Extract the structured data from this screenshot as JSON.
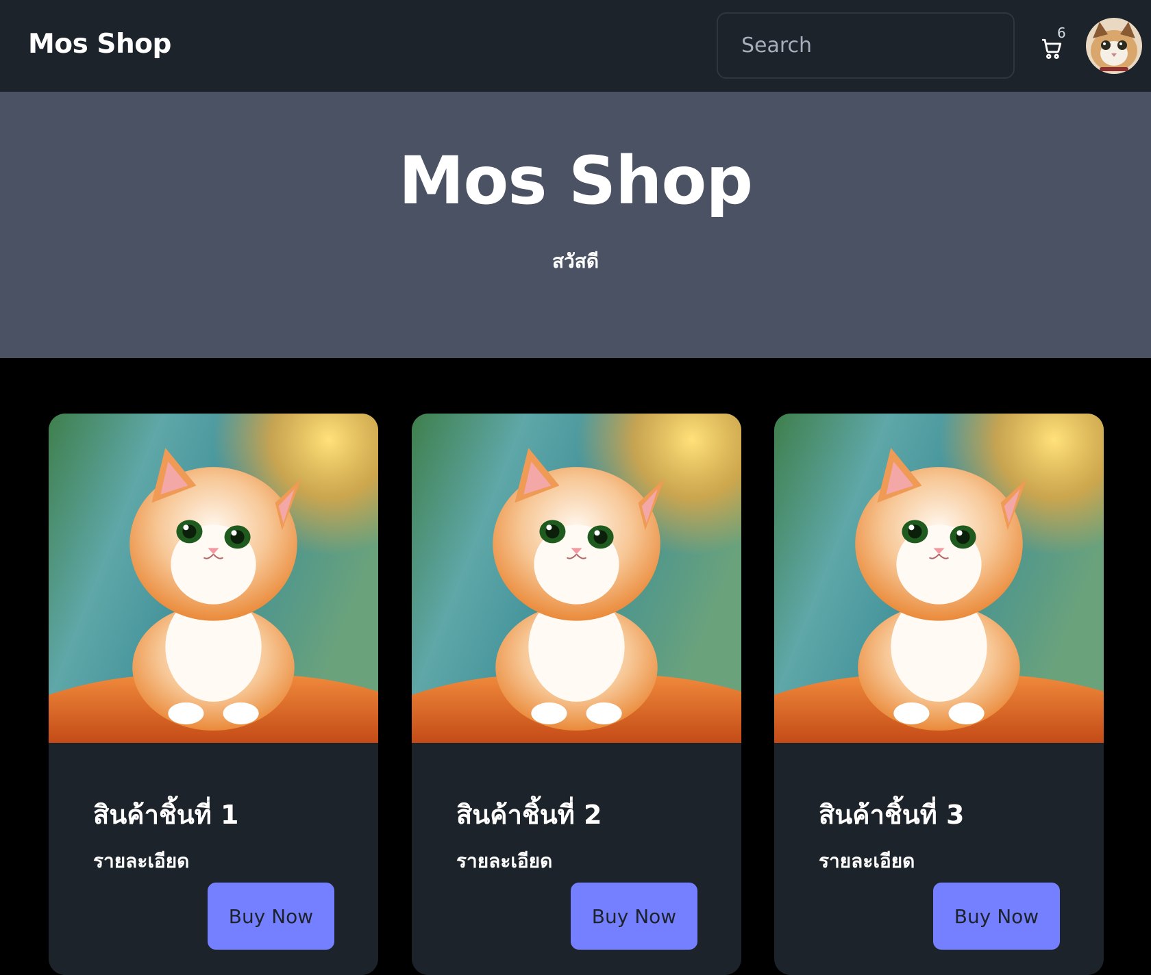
{
  "navbar": {
    "brand": "Mos Shop",
    "search_placeholder": "Search",
    "cart_count": "6",
    "cart_icon": "cart-icon",
    "avatar_icon": "cat-avatar"
  },
  "hero": {
    "title": "Mos Shop",
    "subtitle": "สวัสดี"
  },
  "products": [
    {
      "title": "สินค้าชิ้นที่ 1",
      "description": "รายละเอียด",
      "button": "Buy Now"
    },
    {
      "title": "สินค้าชิ้นที่ 2",
      "description": "รายละเอียด",
      "button": "Buy Now"
    },
    {
      "title": "สินค้าชิ้นที่ 3",
      "description": "รายละเอียด",
      "button": "Buy Now"
    }
  ],
  "colors": {
    "navbar_bg": "#1d232a",
    "hero_bg": "#4a5264",
    "page_bg": "#000000",
    "card_bg": "#1d232a",
    "button_bg": "#7480ff"
  }
}
